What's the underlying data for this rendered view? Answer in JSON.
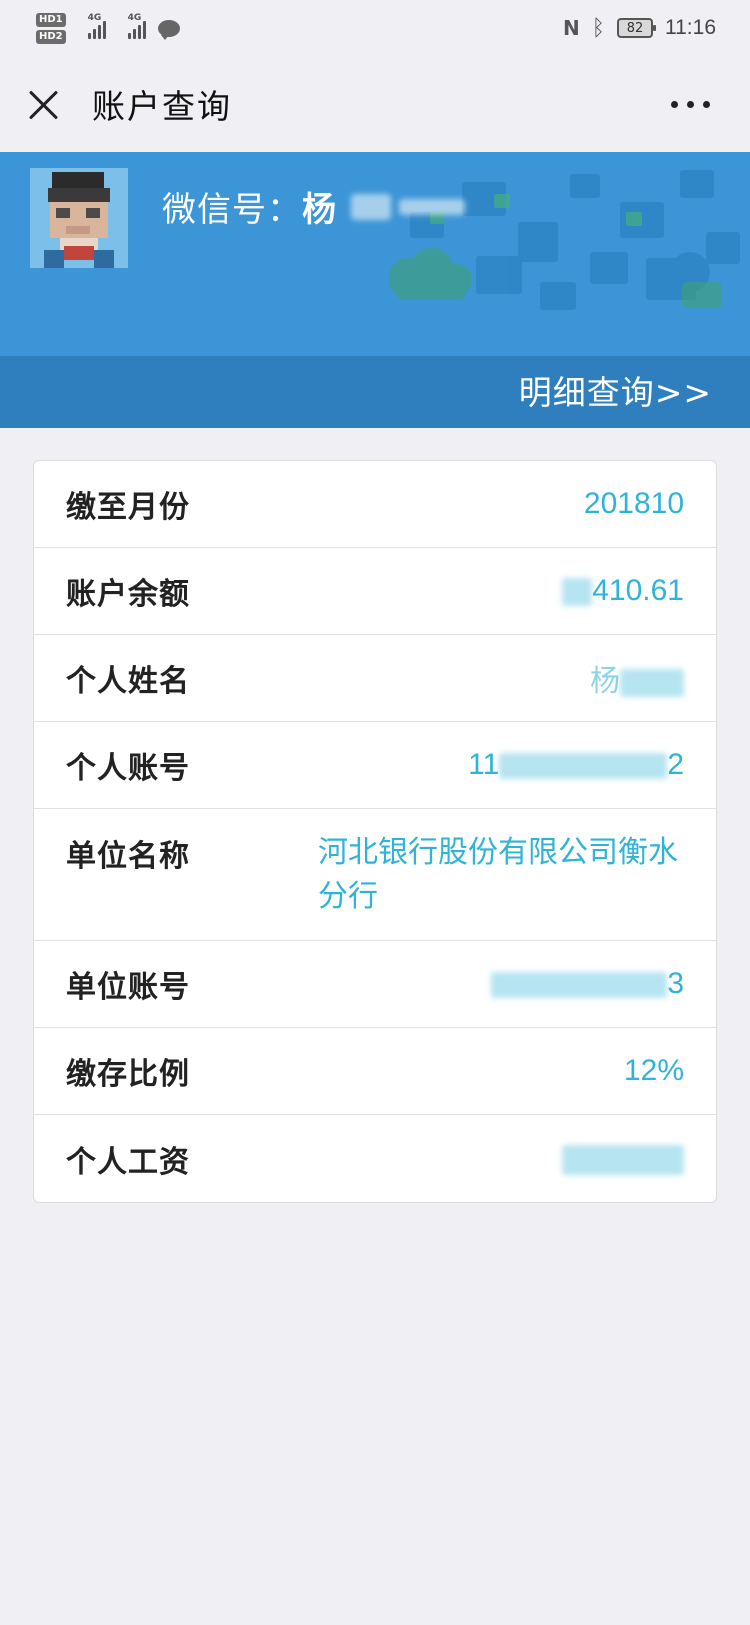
{
  "status_bar": {
    "hd1": "HD1",
    "hd2": "HD2",
    "sim1": "4G",
    "sim2": "4G",
    "battery": "82",
    "time": "11:16",
    "icons": [
      "nfc-icon",
      "bluetooth-icon",
      "wechat-notification-icon"
    ]
  },
  "nav": {
    "title": "账户查询",
    "close_icon": "close-icon",
    "more_icon": "more-icon"
  },
  "header": {
    "wechat_label": "微信号：",
    "wechat_visible": "杨",
    "detail_link": "明细查询>>",
    "banner_color": "#3c95d6",
    "strip_color": "#2f7fbf"
  },
  "account": {
    "rows": [
      {
        "label": "缴至月份",
        "value": "201810"
      },
      {
        "label": "账户余额",
        "value": "410.61",
        "masked": true
      },
      {
        "label": "个人姓名",
        "value": "杨",
        "masked": true
      },
      {
        "label": "个人账号",
        "value_start": "11",
        "value_end": "2",
        "masked": true
      },
      {
        "label": "单位名称",
        "value": "河北银行股份有限公司衡水分行"
      },
      {
        "label": "单位账号",
        "value_end": "3",
        "masked": true
      },
      {
        "label": "缴存比例",
        "value": "12%"
      },
      {
        "label": "个人工资",
        "value": "",
        "masked": true
      }
    ],
    "value_color": "#2fb3d6"
  }
}
